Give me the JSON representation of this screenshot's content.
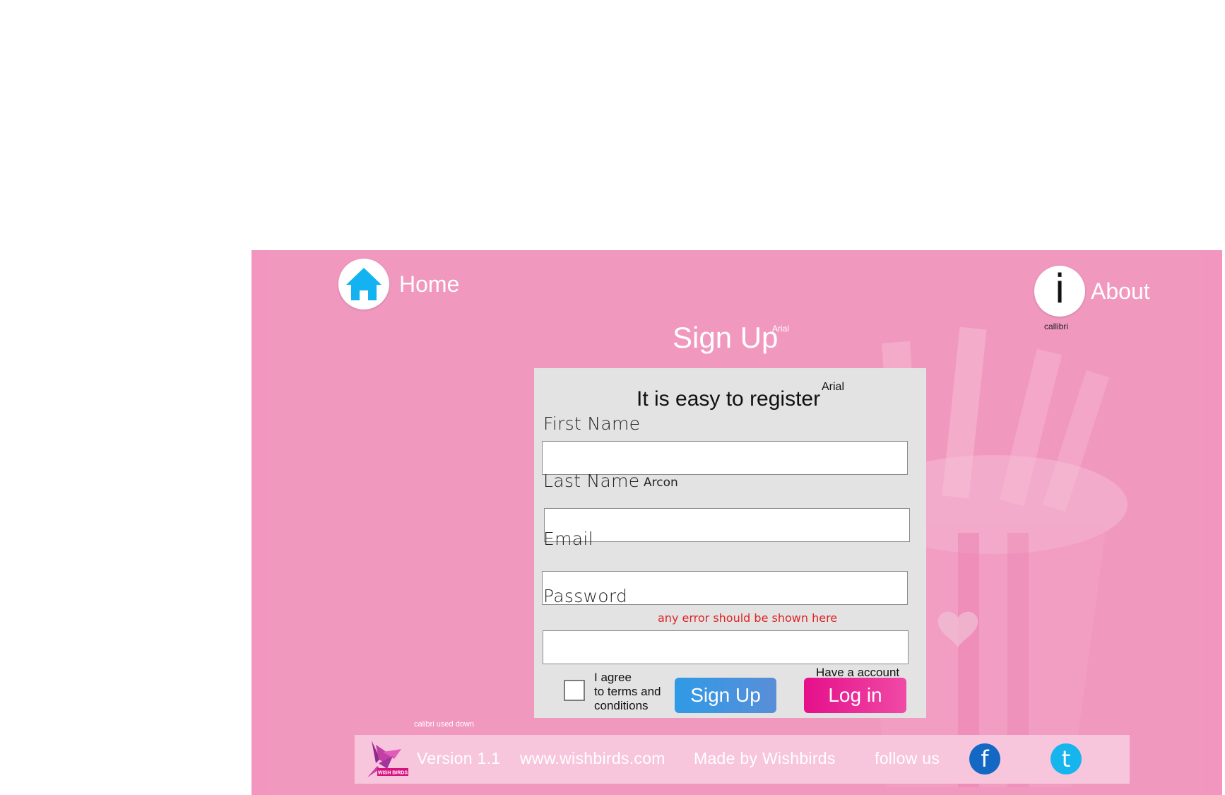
{
  "colors": {
    "page_bg": "#f396bf",
    "card_bg": "#e3e3e3",
    "footer_bg": "#f8c6dc",
    "signup_button": "#3597e2",
    "login_button": "#ec2a98",
    "home_icon": "#12b3f0",
    "facebook": "#1368c4",
    "twitter": "#16b5ee",
    "error": "#e02424"
  },
  "nav": {
    "home_label": "Home",
    "home_icon": "house-icon",
    "about_label": "About",
    "about_glyph": "i",
    "about_note": "callibri"
  },
  "title": {
    "text": "Sign Up",
    "note": "Arial"
  },
  "form": {
    "heading": "It is easy to register",
    "heading_note": "Arial",
    "first_name_label": "First Name",
    "last_name_label": "Last Name",
    "last_name_note": "Arcon",
    "email_label": "Email",
    "password_label": "Password",
    "error_text": "any error should be shown here",
    "agree_line1": "I agree",
    "agree_line2": "to terms and",
    "agree_line3": "conditions",
    "signup_button": "Sign Up",
    "have_account": "Have a account",
    "login_button": "Log in",
    "first_name_value": "",
    "last_name_value": "",
    "email_value": "",
    "password_value": ""
  },
  "footer_note": "calibri used down",
  "footer": {
    "logo_text": "WISH BIRDS",
    "version": "Version 1.1",
    "website": "www.wishbirds.com",
    "made_by": "Made by Wishbirds",
    "follow_us": "follow us",
    "facebook_glyph": "f",
    "twitter_glyph": "t"
  }
}
